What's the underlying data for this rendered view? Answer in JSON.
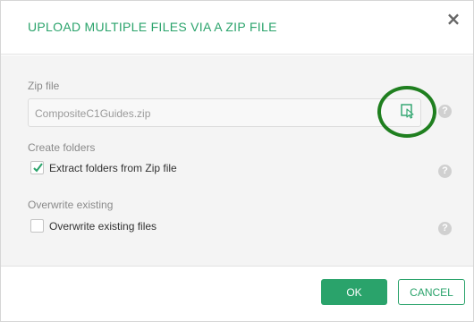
{
  "dialog": {
    "title": "UPLOAD MULTIPLE FILES VIA A ZIP FILE",
    "close_icon": "close-icon"
  },
  "zip": {
    "label": "Zip file",
    "value": "CompositeC1Guides.zip",
    "browse_icon": "file-browse-icon",
    "help": "?"
  },
  "create_folders": {
    "label": "Create folders",
    "checkbox_label": "Extract folders from Zip file",
    "checked": true,
    "help": "?"
  },
  "overwrite": {
    "label": "Overwrite existing",
    "checkbox_label": "Overwrite existing files",
    "checked": false,
    "help": "?"
  },
  "footer": {
    "ok_label": "OK",
    "cancel_label": "CANCEL"
  },
  "colors": {
    "accent": "#2aa36b",
    "highlight_ring": "#1f7f1f"
  }
}
